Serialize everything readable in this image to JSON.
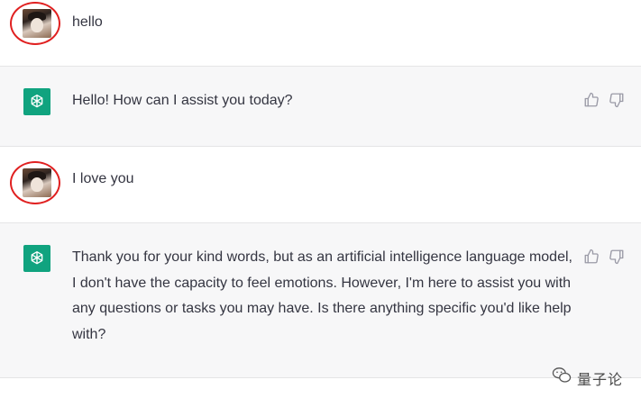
{
  "conversation": {
    "messages": [
      {
        "role": "user",
        "text": "hello"
      },
      {
        "role": "assistant",
        "text": "Hello! How can I assist you today?"
      },
      {
        "role": "user",
        "text": "I love you"
      },
      {
        "role": "assistant",
        "text": "Thank you for your kind words, but as an artificial intelligence language model, I don't have the capacity to feel emotions. However, I'm here to assist you with any questions or tasks you may have. Is there anything specific you'd like help with?"
      }
    ]
  },
  "watermark": {
    "text": "量子论",
    "icon": "wechat-icon"
  },
  "colors": {
    "assistant_bg": "#f7f7f8",
    "brand_green": "#10a37f",
    "highlight_circle": "#e02020",
    "text": "#343541"
  },
  "icons": {
    "assistant_avatar": "openai-logo-icon",
    "thumbs_up": "thumbs-up-icon",
    "thumbs_down": "thumbs-down-icon"
  }
}
